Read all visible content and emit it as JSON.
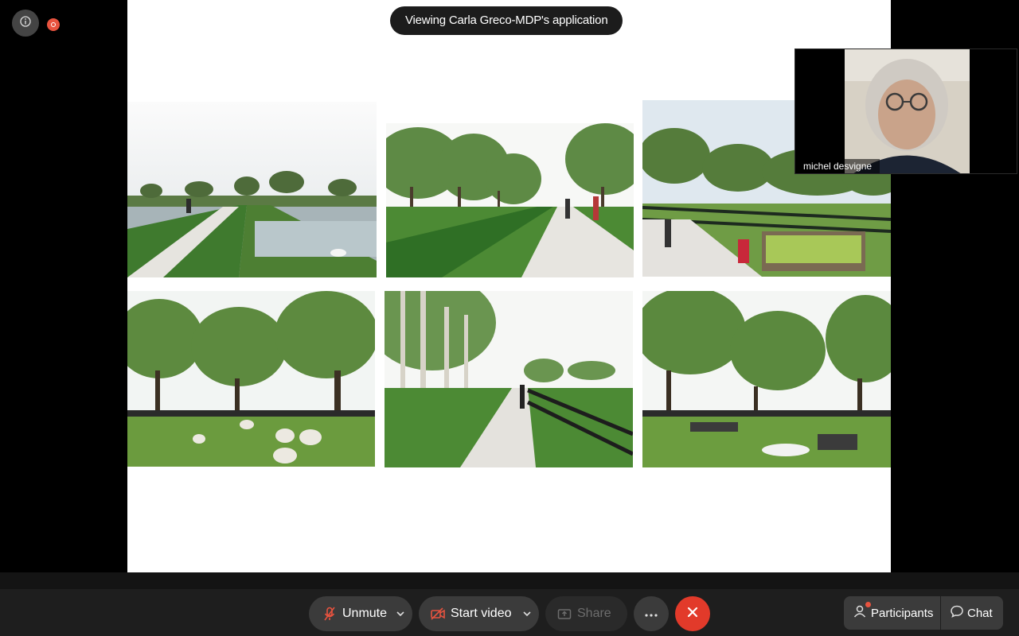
{
  "share_banner": "Viewing Carla Greco-MDP's application",
  "video_participant": "michel desvigne",
  "toolbar": {
    "unmute": "Unmute",
    "start_video": "Start video",
    "share": "Share",
    "participants": "Participants",
    "chat": "Chat"
  },
  "icons": {
    "info": "info-icon",
    "recording": "recording-indicator-icon",
    "mic_muted": "mic-off-icon",
    "video_off": "video-off-icon",
    "share": "share-screen-icon",
    "more": "more-icon",
    "end": "end-call-icon",
    "participants": "participants-icon",
    "chat": "chat-icon"
  },
  "colors": {
    "end_call": "#e23a2a",
    "recording": "#e8533f",
    "mic_off": "#e8533f",
    "toolbar_bg": "#1e1e1e",
    "button_bg": "#3b3b3b"
  }
}
